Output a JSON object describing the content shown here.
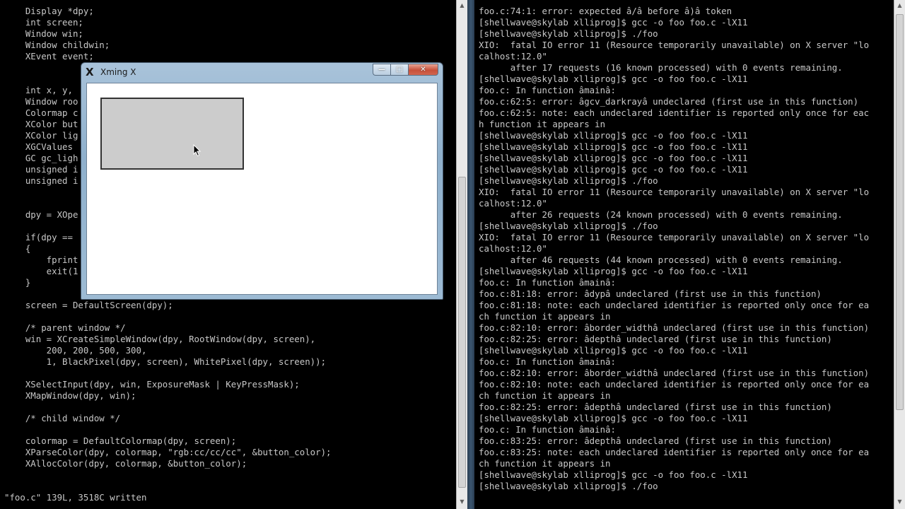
{
  "left_terminal": {
    "lines": [
      "    Display *dpy;",
      "    int screen;",
      "    Window win;",
      "    Window childwin;",
      "    XEvent event;",
      "",
      "",
      "    int x, y, ",
      "    Window roo",
      "    Colormap c",
      "    XColor but",
      "    XColor lig",
      "    XGCValues ",
      "    GC gc_ligh",
      "    unsigned i",
      "    unsigned i",
      "",
      "",
      "    dpy = XOpe",
      "",
      "    if(dpy == ",
      "    {",
      "        fprint",
      "        exit(1",
      "    }",
      "",
      "    screen = DefaultScreen(dpy);",
      "",
      "    /* parent window */",
      "    win = XCreateSimpleWindow(dpy, RootWindow(dpy, screen),",
      "        200, 200, 500, 300,",
      "        1, BlackPixel(dpy, screen), WhitePixel(dpy, screen));",
      "",
      "    XSelectInput(dpy, win, ExposureMask | KeyPressMask);",
      "    XMapWindow(dpy, win);",
      "",
      "    /* child window */",
      "",
      "    colormap = DefaultColormap(dpy, screen);",
      "    XParseColor(dpy, colormap, \"rgb:cc/cc/cc\", &button_color);",
      "    XAllocColor(dpy, colormap, &button_color);"
    ],
    "status": "\"foo.c\" 139L, 3518C written"
  },
  "right_terminal": {
    "lines": [
      "foo.c:74:1: error: expected â/â before â)â token",
      "[shellwave@skylab xlliprog]$ gcc -o foo foo.c -lX11",
      "[shellwave@skylab xlliprog]$ ./foo",
      "XIO:  fatal IO error 11 (Resource temporarily unavailable) on X server \"lo",
      "calhost:12.0\"",
      "      after 17 requests (16 known processed) with 0 events remaining.",
      "[shellwave@skylab xlliprog]$ gcc -o foo foo.c -lX11",
      "foo.c: In function âmainâ:",
      "foo.c:62:5: error: âgcv_darkrayâ undeclared (first use in this function)",
      "foo.c:62:5: note: each undeclared identifier is reported only once for eac",
      "h function it appears in",
      "[shellwave@skylab xlliprog]$ gcc -o foo foo.c -lX11",
      "[shellwave@skylab xlliprog]$ gcc -o foo foo.c -lX11",
      "[shellwave@skylab xlliprog]$ gcc -o foo foo.c -lX11",
      "[shellwave@skylab xlliprog]$ gcc -o foo foo.c -lX11",
      "[shellwave@skylab xlliprog]$ ./foo",
      "XIO:  fatal IO error 11 (Resource temporarily unavailable) on X server \"lo",
      "calhost:12.0\"",
      "      after 26 requests (24 known processed) with 0 events remaining.",
      "[shellwave@skylab xlliprog]$ ./foo",
      "XIO:  fatal IO error 11 (Resource temporarily unavailable) on X server \"lo",
      "calhost:12.0\"",
      "      after 46 requests (44 known processed) with 0 events remaining.",
      "[shellwave@skylab xlliprog]$ gcc -o foo foo.c -lX11",
      "foo.c: In function âmainâ:",
      "foo.c:81:18: error: âdypâ undeclared (first use in this function)",
      "foo.c:81:18: note: each undeclared identifier is reported only once for ea",
      "ch function it appears in",
      "foo.c:82:10: error: âborder_widthâ undeclared (first use in this function)",
      "foo.c:82:25: error: âdepthâ undeclared (first use in this function)",
      "[shellwave@skylab xlliprog]$ gcc -o foo foo.c -lX11",
      "foo.c: In function âmainâ:",
      "foo.c:82:10: error: âborder_widthâ undeclared (first use in this function)",
      "foo.c:82:10: note: each undeclared identifier is reported only once for ea",
      "ch function it appears in",
      "foo.c:82:25: error: âdepthâ undeclared (first use in this function)",
      "[shellwave@skylab xlliprog]$ gcc -o foo foo.c -lX11",
      "foo.c: In function âmainâ:",
      "foo.c:83:25: error: âdepthâ undeclared (first use in this function)",
      "foo.c:83:25: note: each undeclared identifier is reported only once for ea",
      "ch function it appears in",
      "[shellwave@skylab xlliprog]$ gcc -o foo foo.c -lX11",
      "[shellwave@skylab xlliprog]$ ./foo"
    ]
  },
  "xming_window": {
    "title": "Xming X",
    "icon": "x-logo-icon",
    "minimize_glyph": "—",
    "maximize_glyph": "□",
    "close_glyph": "✕"
  },
  "colors": {
    "terminal_bg": "#000000",
    "terminal_text": "#c8c8c8",
    "child_window_fill": "#cccccc"
  }
}
